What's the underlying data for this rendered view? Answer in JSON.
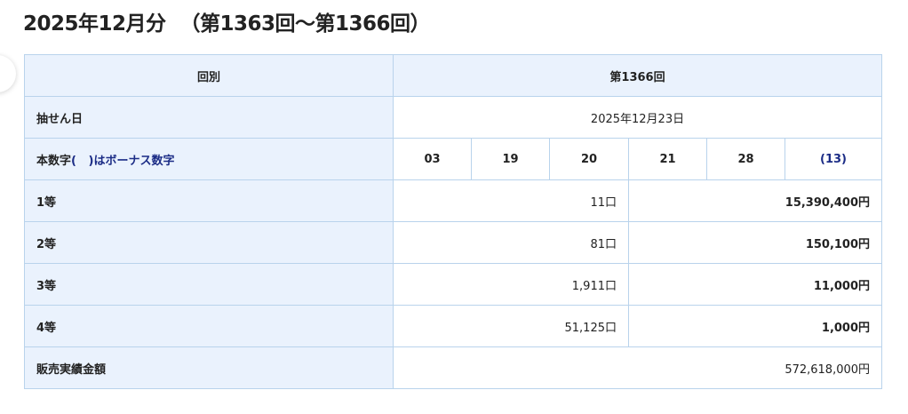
{
  "heading": {
    "title": "2025年12月分",
    "range": "（第1363回〜第1366回）"
  },
  "table": {
    "header": {
      "label": "回別",
      "value": "第1366回"
    },
    "draw_date": {
      "label": "抽せん日",
      "value": "2025年12月23日"
    },
    "numbers": {
      "label_prefix": "本数字",
      "label_paren_open": "(",
      "label_paren_close": ")",
      "label_suffix": "はボーナス数字",
      "main": [
        "03",
        "19",
        "20",
        "21",
        "28"
      ],
      "bonus": "(13)"
    },
    "prizes": [
      {
        "rank": "1等",
        "winners": "11口",
        "amount": "15,390,400円"
      },
      {
        "rank": "2等",
        "winners": "81口",
        "amount": "150,100円"
      },
      {
        "rank": "3等",
        "winners": "1,911口",
        "amount": "11,000円"
      },
      {
        "rank": "4等",
        "winners": "51,125口",
        "amount": "1,000円"
      }
    ],
    "sales": {
      "label": "販売実績金額",
      "value": "572,618,000円"
    }
  },
  "colors": {
    "header_bg": "#eaf2fd",
    "border": "#b9d3ec",
    "bonus_text": "#1b2c86"
  }
}
